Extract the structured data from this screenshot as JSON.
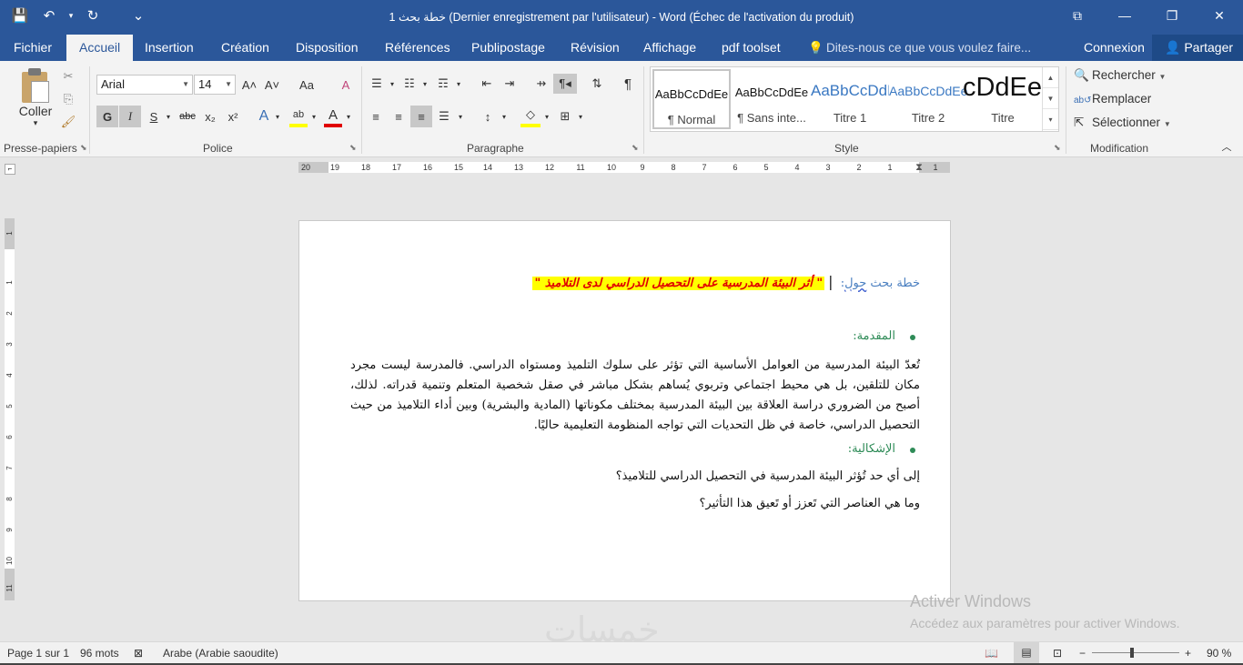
{
  "titlebar": {
    "title": "خطة بحث 1 (Dernier enregistrement par l'utilisateur) - Word (Échec de l'activation du produit)",
    "qat": {
      "save_icon": "💾",
      "undo_icon": "↶",
      "redo_icon": "↻",
      "customize_icon": "⌄"
    },
    "controls": {
      "restore_ribbon": "⧉",
      "minimize": "—",
      "maximize": "❐",
      "close": "✕"
    }
  },
  "tabs": [
    {
      "label": "Fichier"
    },
    {
      "label": "Accueil"
    },
    {
      "label": "Insertion"
    },
    {
      "label": "Création"
    },
    {
      "label": "Disposition"
    },
    {
      "label": "Références"
    },
    {
      "label": "Publipostage"
    },
    {
      "label": "Révision"
    },
    {
      "label": "Affichage"
    },
    {
      "label": "pdf toolset"
    }
  ],
  "tellme": "Dites-nous ce que vous voulez faire...",
  "account": {
    "signin": "Connexion",
    "share": "Partager"
  },
  "ribbon": {
    "clipboard": {
      "label": "Presse-papiers",
      "paste": "Coller"
    },
    "font": {
      "label": "Police",
      "name": "Arial",
      "size": "14",
      "grow": "A˄",
      "shrink": "A˅",
      "case": "Aa",
      "clear": "A",
      "bold": "G",
      "italic": "I",
      "underline": "S",
      "strike": "abc",
      "sub": "x₂",
      "sup": "x²",
      "effects": "A",
      "highlight": "ab",
      "color": "A"
    },
    "paragraph": {
      "label": "Paragraphe",
      "pilcrow": "¶"
    },
    "styles": {
      "label": "Style",
      "items": [
        {
          "preview": "AaBbCcDdEe",
          "name": "¶ Normal"
        },
        {
          "preview": "AaBbCcDdEe",
          "name": "¶ Sans inte..."
        },
        {
          "preview": "AaBbCcDdEe",
          "name": "Titre 1"
        },
        {
          "preview": "AaBbCcDdEe",
          "name": "Titre 2"
        },
        {
          "preview": "AaBbCcDdEe",
          "name": "Titre"
        }
      ]
    },
    "editing": {
      "label": "Modification",
      "find": "Rechercher",
      "replace": "Remplacer",
      "select": "Sélectionner"
    }
  },
  "ruler": {
    "h_ticks": [
      "20",
      "19",
      "18",
      "17",
      "16",
      "15",
      "14",
      "13",
      "12",
      "11",
      "10",
      "9",
      "8",
      "7",
      "6",
      "5",
      "4",
      "3",
      "2",
      "1",
      "1"
    ],
    "v_ticks": [
      "1",
      "1",
      "2",
      "3",
      "4",
      "5",
      "6",
      "7",
      "8",
      "9",
      "10",
      "11"
    ]
  },
  "document": {
    "title_prefix": "خطة بحث ",
    "title_squiggle": "حول",
    "title_sep": ": ",
    "title_highlight": "\" أثر البيئة المدرسية على التحصيل الدراسي لدى التلاميذ \"",
    "h1": "المقدمة:",
    "p1": "تُعدّ البيئة المدرسية من العوامل الأساسية التي تؤثر على سلوك التلميذ ومستواه الدراسي. فالمدرسة ليست مجرد مكان للتلقين، بل هي محيط اجتماعي وتربوي يُساهم بشكل مباشر في صقل شخصية المتعلم وتنمية قدراته. لذلك، أصبح من الضروري دراسة العلاقة بين البيئة المدرسية بمختلف مكوناتها (المادية والبشرية) وبين أداء التلاميذ من حيث التحصيل الدراسي، خاصة في ظل التحديات التي تواجه المنظومة التعليمية حاليًا.",
    "h2": "الإشكالية:",
    "q1": "إلى أي حد تُؤثر البيئة المدرسية في التحصيل الدراسي للتلاميذ؟",
    "q2": "وما هي العناصر التي تَعزز أو تَعيق هذا التأثير؟"
  },
  "watermark": {
    "line1": "Activer Windows",
    "line2": "Accédez aux paramètres pour activer Windows."
  },
  "statusbar": {
    "page": "Page 1 sur 1",
    "words": "96 mots",
    "language": "Arabe (Arabie saoudite)",
    "zoom_minus": "−",
    "zoom_plus": "+",
    "zoom": "90 %"
  },
  "colors": {
    "accent": "#2b579a",
    "highlight": "#ffff00",
    "heading": "#2e8b57"
  }
}
